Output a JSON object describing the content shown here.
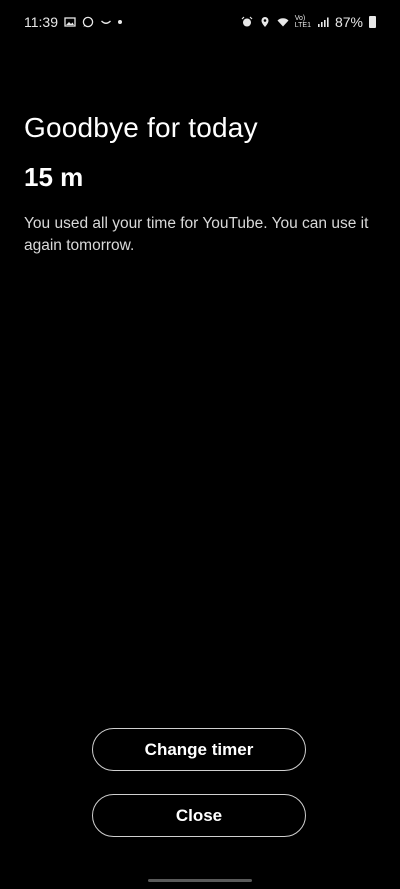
{
  "status_bar": {
    "time": "11:39",
    "battery_percent": "87%",
    "volte_top": "Vo)",
    "volte_bottom": "LTE1",
    "icons": [
      "gallery-icon",
      "whatsapp-icon",
      "smile-icon",
      "dot-icon",
      "alarm-icon",
      "location-icon",
      "wifi-icon",
      "signal-icon",
      "battery-icon"
    ]
  },
  "screen": {
    "title": "Goodbye for today",
    "time_used": "15 m",
    "message": "You used all your time for YouTube. You can use it again tomorrow."
  },
  "buttons": {
    "change_timer": "Change timer",
    "close": "Close"
  }
}
